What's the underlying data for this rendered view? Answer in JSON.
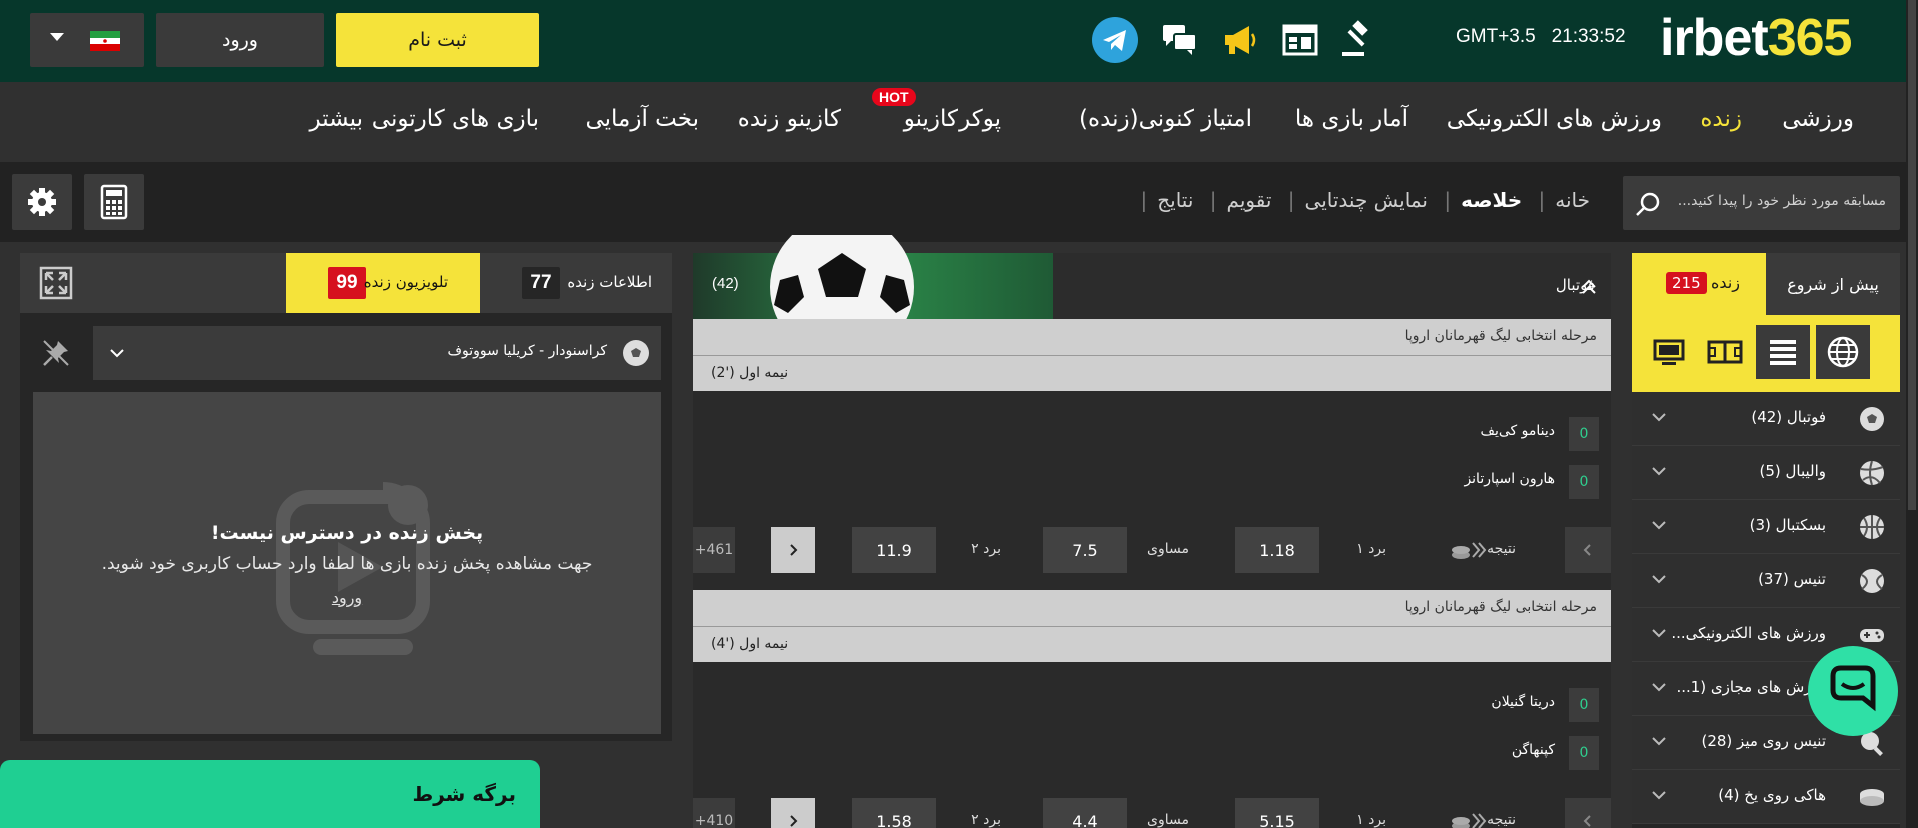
{
  "header": {
    "logo_white": "irbet",
    "logo_yellow": "365",
    "time": "21:33:52",
    "timezone": "GMT+3.5",
    "login_label": "ورود",
    "register_label": "ثبت نام",
    "language": "fa"
  },
  "nav": {
    "items": [
      "ورزشی",
      "زنده",
      "ورزش های الکترونیکی",
      "آمار بازی ها",
      "امتیاز کنونی(زنده)",
      "پوکر",
      "کازینو",
      "کازینو زنده",
      "بخت آزمایی",
      "بازی های کارتونی",
      "بیشتر"
    ],
    "active": "زنده",
    "hot_badge": "HOT"
  },
  "subbar": {
    "search_placeholder": "مسابقه مورد نظر خود را پیدا کنید...",
    "crumbs": [
      "خانه",
      "خلاصه",
      "نمایش چندتایی",
      "تقویم",
      "نتایج"
    ],
    "active_crumb": "خلاصه"
  },
  "sidebar": {
    "tab_live": "زنده",
    "tab_live_count": "215",
    "tab_prematch": "پیش از شروع",
    "sports": [
      {
        "label": "فوتبال (42)",
        "icon": "soccer-icon"
      },
      {
        "label": "والیبال (5)",
        "icon": "volleyball-icon"
      },
      {
        "label": "بسکتبال (3)",
        "icon": "basketball-icon"
      },
      {
        "label": "تنیس (37)",
        "icon": "tennis-icon"
      },
      {
        "label": "ورزش های الکترونیکی...",
        "icon": "gamepad-icon"
      },
      {
        "label": "ورزش های مجازی (1...",
        "icon": "virtual-icon"
      },
      {
        "label": "تنیس روی میز (28)",
        "icon": "table-tennis-icon"
      },
      {
        "label": "هاکی روی یخ (4)",
        "icon": "hockey-icon"
      }
    ]
  },
  "center": {
    "sport_title": "فوتبال",
    "sport_count": "(42)",
    "matches": [
      {
        "league": "مرحله انتخابی لیگ قهرمانان اروپا",
        "period": "نیمه اول ('2)",
        "team1": "دینامو کی‌یف",
        "score1": "0",
        "team2": "هارون اسپارتانز",
        "score2": "0",
        "market": "نتیجه",
        "label_w1": "برد ۱",
        "odd_w1": "1.18",
        "label_draw": "مساوی",
        "odd_draw": "7.5",
        "label_w2": "برد ۲",
        "odd_w2": "11.9",
        "more": "+461"
      },
      {
        "league": "مرحله انتخابی لیگ قهرمانان اروپا",
        "period": "نیمه اول ('4)",
        "team1": "دریتا گنیلان",
        "score1": "0",
        "team2": "کپنهاگن",
        "score2": "0",
        "market": "نتیجه",
        "label_w1": "برد ۱",
        "odd_w1": "5.15",
        "label_draw": "مساوی",
        "odd_draw": "4.4",
        "label_w2": "برد ۲",
        "odd_w2": "1.58",
        "more": "+410"
      }
    ]
  },
  "leftpanel": {
    "tab_info": "اطلاعات زنده",
    "tab_info_count": "77",
    "tab_tv": "تلویزیون زنده",
    "tab_tv_count": "99",
    "selected_match": "کراسنودار - کریلیا سووتوف",
    "stream_title": "پخش زنده در دسترس نیست!",
    "stream_msg": "جهت مشاهده پخش زنده بازی ها لطفا وارد حساب کاربری خود شوید.",
    "stream_login": "ورود"
  },
  "betslip": {
    "title": "برگه شرط"
  },
  "colors": {
    "header_bg": "#06372b",
    "accent_yellow": "#f5e33a",
    "hot_red": "#e8061b",
    "green": "#1fcf92"
  }
}
